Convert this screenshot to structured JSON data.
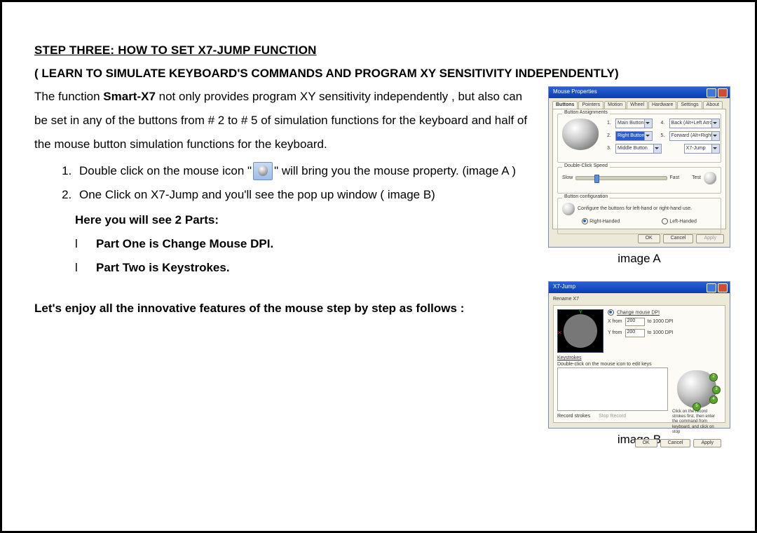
{
  "head": {
    "title": "STEP THREE:    HOW TO SET X7-JUMP FUNCTION",
    "subtitle": "( LEARN TO SIMULATE KEYBOARD'S COMMANDS AND PROGRAM XY SENSITIVITY INDEPENDENTLY)"
  },
  "intro": {
    "pre": "The function ",
    "bold": "Smart-X7",
    "post": " not only provides program XY sensitivity independently , but also can be set in any of the buttons from # 2 to # 5 of simulation functions for the keyboard and half of the mouse button simulation functions for the keyboard."
  },
  "steps": {
    "s1a": "Double click on the mouse icon \"",
    "s1b": "\" will bring you the mouse property. (image A )",
    "s2": "One Click on X7-Jump and you'll see the pop up window ( image B)"
  },
  "parts": {
    "head": "Here you will see 2 Parts:",
    "bullet_sym": "l",
    "p1": "Part One is Change Mouse DPI.",
    "p2": "Part Two is Keystrokes."
  },
  "enjoy": "Let's enjoy all the innovative features of the mouse step by step as follows :",
  "figcaps": {
    "a": "image A",
    "b": "image B"
  },
  "figA": {
    "wintitle": "Mouse Properties",
    "tabs": [
      "Buttons",
      "Pointers",
      "Motion",
      "Wheel",
      "Hardware",
      "Settings",
      "About"
    ],
    "group1": "Button Assignments",
    "opts": {
      "n1": "1.",
      "v1": "Main Button",
      "n4": "4.",
      "v4": "Back (Alt+Left Arrow)",
      "n2": "2.",
      "v2": "Right Button",
      "n5": "5.",
      "v5": "Forward (Alt+Right Arrow)",
      "n3": "3.",
      "v3": "Middle Button",
      "nx": "",
      "vx": "X7-Jump"
    },
    "group2": "Double-Click Speed",
    "slow": "Slow",
    "fast": "Fast",
    "test": "Test",
    "group3": "Button configuration",
    "cfgtext": "Configure the buttons for left-hand or right-hand use.",
    "rh": "Right-Handed",
    "lh": "Left-Handed",
    "ok": "OK",
    "cancel": "Cancel",
    "apply": "Apply"
  },
  "figB": {
    "wintitle": "X7-Jump",
    "tabhead": "Rename X7",
    "p1": "Change mouse DPI",
    "xlabel": "X from",
    "xval": "200",
    "xto": "to 1000 DPI",
    "ylabel": "Y from",
    "yval": "200",
    "yto": "to 1000 DPI",
    "p2": "Keystrokes",
    "p2text": "Double-click on the mouse icon to edit keys",
    "recstrokes": "Record strokes",
    "stoprecord": "Stop Record",
    "hint": "Click on the record strokes first, then enter the command from keyboard, and click on stop",
    "ok": "OK",
    "cancel": "Cancel",
    "apply": "Apply",
    "d2": "2",
    "d3": "3",
    "d4": "4",
    "d5": "5"
  }
}
